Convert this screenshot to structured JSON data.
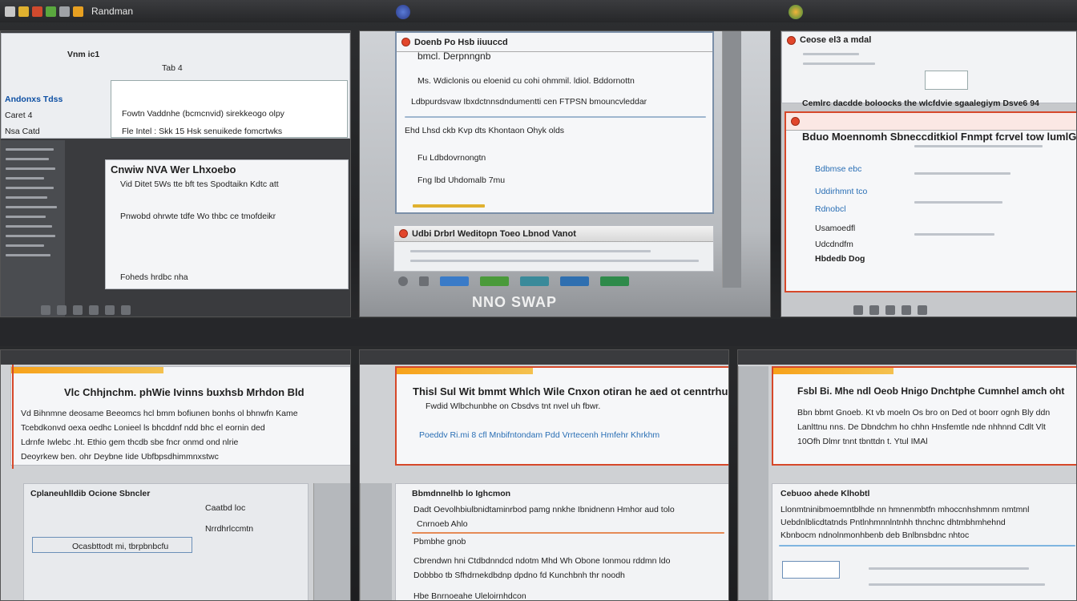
{
  "topbar": {
    "label": "Randman",
    "icons": [
      "app-icon-1",
      "app-icon-2",
      "app-icon-3",
      "app-icon-4",
      "app-icon-5",
      "app-icon-6"
    ]
  },
  "tile1": {
    "breadcrumb": "Vnm ic1",
    "tab_label": "Tab 4",
    "sidebar_items": [
      "Andonxs Tdss",
      "Caret 4",
      "Nsa Catd"
    ],
    "rows": [
      "Fowtn Vaddnhe (bcmcnvid) sirekkeogo olpy",
      "Fle Intel : Skk 15 Hsk senuikede fomcrtwks",
      "Cnwiw NVA Wer Lhxoebo",
      "Vid Ditet 5Ws tte bft tes Spodtaikn Kdtc att",
      "Pnwobd ohrwte tdfe Wo  thbc ce tmofdeikr",
      "Foheds hrdbc nha"
    ]
  },
  "tile2": {
    "title": "Doenb Po Hsb iiuuccd",
    "subtitle": "bmcl. Derpnngnb",
    "line1": "Ms. Wdiclonis ou eloenid cu cohi ohmmil. ldiol. Bddornottn",
    "line2": "Ldbpurdsvaw Ibxdctnnsdndumentti cen FTPSN bmouncvleddar",
    "line3": "Ehd Lhsd ckb Kvp dts Khontaon Ohyk olds",
    "line4": "Fu Ldbdovrnongtn",
    "line5": "Fng lbd Uhdomalb 7mu",
    "subwin_title": "Udbi Drbrl Weditopn Toeo Lbnod Vanot",
    "bottom_text": "NNO SWAP"
  },
  "tile3": {
    "title": "Ceose el3 a mdal",
    "banner": "Cemlrc dacdde boloocks the wlcfdvie sgaalegiym Dsve6 94",
    "subtitle": "Bduo Moennomh Sbneccditkiol Fnmpt fcrvel tow lumlGstme",
    "rows": [
      "Bdbmse ebc",
      "Uddirhmnt tco",
      "Rdnobcl",
      "Usamoedfl",
      "Udcdndfm",
      "Hbdedb Dog"
    ]
  },
  "tile4": {
    "heading": "Vlc Chhjnchm. phWie Ivinns buxhsb Mrhdon Bld",
    "para": [
      "Vd Bihnmne deosame Beeomcs hcl bmm bofiunen bonhs ol bhnwfn Kame",
      "Tcebdkonvd oexa oedhc Lonieel ls bhcddnf ndd bhc el eornin ded",
      "Ldrnfe Iwlebc .ht. Ethio gem thcdb sbe fncr onmd ond nlrie",
      "Deoyrkew ben. ohr Deybne Iide Ubfbpsdhimmnxstwc"
    ],
    "sub_heading": "Cplaneuhlldib Ocione Sbncler",
    "sub_rows": [
      "Ocasbttodt  mi, tbrpbnbcfu",
      "Caatbd loc",
      "Nrrdhrlccmtn"
    ]
  },
  "tile5": {
    "heading": "Thisl Sul Wit bmmt Whlch Wile Cnxon otiran he aed ot cenntrhune",
    "sub": "Fwdid Wlbchunbhe on Cbsdvs tnt nvel uh fbwr.",
    "link_line": "Poeddv Ri.mi 8 cfl Mnbifntondam Pdd Vrrtecenh Hmfehr Khrkhm",
    "lower_title": "Bbmdnnelhb lo Ighcmon",
    "lower_rows": [
      "Dadt Oevolhbiulbnidtaminrbod pamg nnkhe Ibnidnenn Hmhor aud tolo",
      "Cnrnoeb Ahlo",
      "Pbmbhe gnob",
      "Cbrendwn hni Ctdbdnndcd ndotm Mhd Wh Obone Ionmou rddmn ldo",
      "Dobbbo tb Sfhdrnekdbdnp dpdno fd Kunchbnh thr noodh",
      "Hbe Bnrnoeahe Uleloirnhdcon"
    ]
  },
  "tile6": {
    "heading": "Fsbl Bi. Mhe ndl Oeob Hnigo Dnchtphe Cumnhel amch oht",
    "rows": [
      "Bbn bbmt Gnoeb. Kt vb moeln Os bro on Ded ot boorr ognh Bly ddn",
      "Lanlttnu nns. De Dbndchm ho chhn Hnsfemtle nde nhhnnd Cdlt Vlt",
      "10Ofh Dlmr tnnt tbnttdn t. Ytul IMAl"
    ],
    "lower_title": "Cebuoo ahede Klhobtl",
    "lower_rows": [
      "Llonmtninibmoemntblhde nn hmnenmbtfn mhoccnhshmnm nmtmnl",
      "Uebdnlblicdtatnds Pntlnhmnnlntnhh thnchnc dhtmbhmhehnd",
      "Kbnbocm ndnolnmonhbenb deb Bnlbnsbdnc nhtoc"
    ]
  },
  "colors": {
    "accent_red": "#d6482a",
    "accent_orange": "#f7a21b",
    "link_blue": "#2a6fb5"
  }
}
